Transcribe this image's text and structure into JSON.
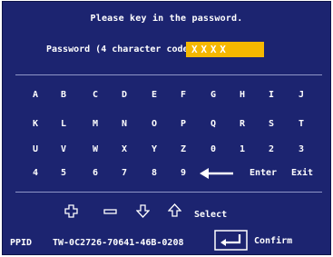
{
  "dialog": {
    "title": "Please key in the password.",
    "password_label": "Password (4 character code):",
    "password_value": "XXXX"
  },
  "keypad": {
    "rows": [
      [
        "A",
        "B",
        "C",
        "D",
        "E",
        "F",
        "G",
        "H",
        "I",
        "J"
      ],
      [
        "K",
        "L",
        "M",
        "N",
        "O",
        "P",
        "Q",
        "R",
        "S",
        "T"
      ],
      [
        "U",
        "V",
        "W",
        "X",
        "Y",
        "Z",
        "0",
        "1",
        "2",
        "3"
      ],
      [
        "4",
        "5",
        "6",
        "7",
        "8",
        "9"
      ]
    ],
    "backspace_icon": "left-arrow-icon",
    "enter_label": "Enter",
    "exit_label": "Exit"
  },
  "nav": {
    "icons": [
      "plus-icon",
      "minus-icon",
      "down-arrow-icon",
      "up-arrow-icon"
    ],
    "select_label": "Select"
  },
  "footer": {
    "ppid_label": "PPID",
    "ppid_value": "TW-0C2726-70641-46B-0208",
    "enter_key_icon": "enter-key-icon",
    "confirm_label": "Confirm"
  },
  "colors": {
    "background": "#1c2470",
    "highlight": "#f5b800",
    "text": "#ffffff",
    "separator": "#8f96c7"
  }
}
